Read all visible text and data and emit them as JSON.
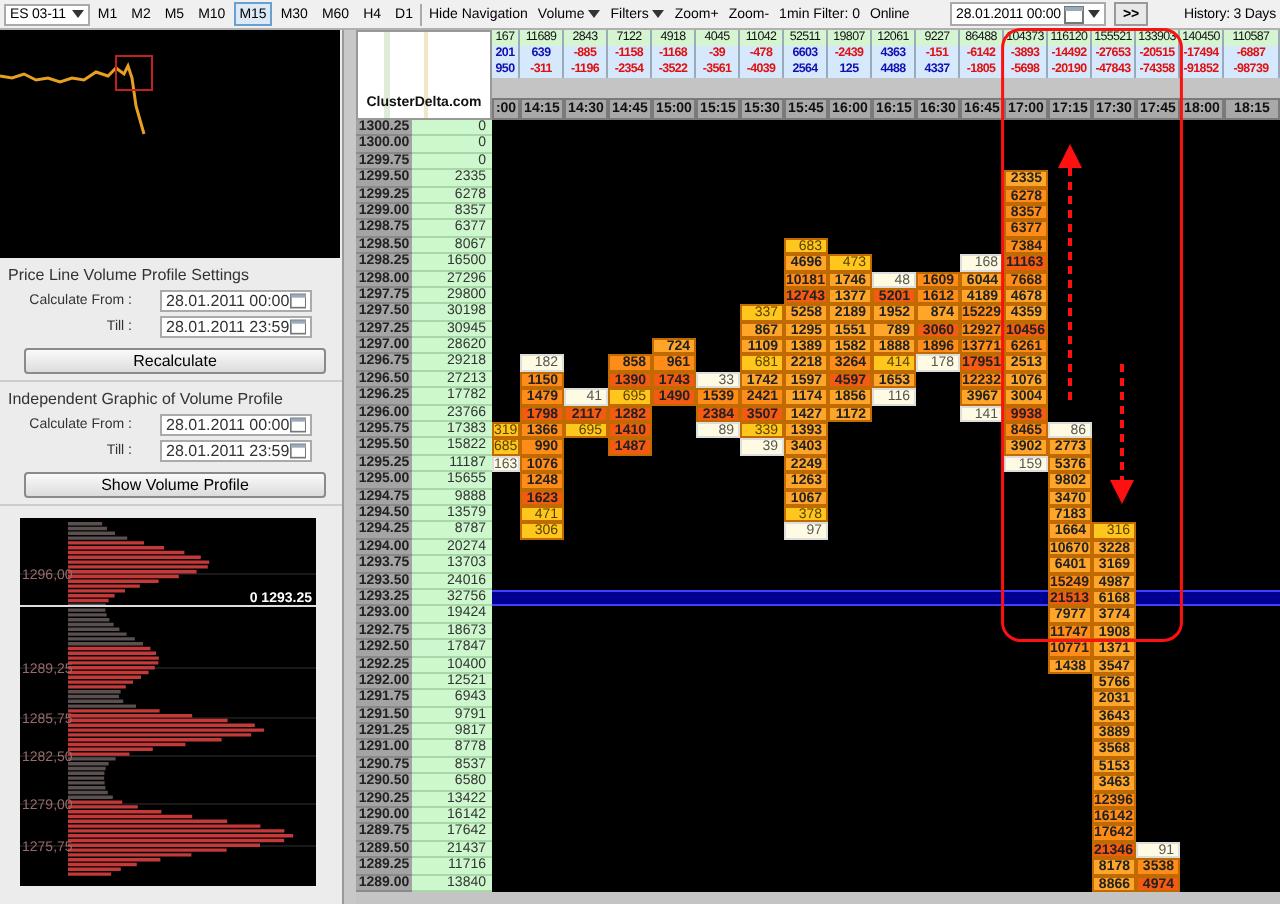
{
  "toolbar": {
    "symbol": "ES 03-11",
    "timeframes": [
      {
        "label": "M1",
        "selected": false
      },
      {
        "label": "M2",
        "selected": false
      },
      {
        "label": "M5",
        "selected": false
      },
      {
        "label": "M10",
        "selected": false
      },
      {
        "label": "M15",
        "selected": true
      },
      {
        "label": "M30",
        "selected": false
      },
      {
        "label": "M60",
        "selected": false
      },
      {
        "label": "H4",
        "selected": false
      },
      {
        "label": "D1",
        "selected": false
      }
    ],
    "actions": [
      {
        "label": "Hide Navigation",
        "kind": "button"
      },
      {
        "label": "Volume",
        "kind": "menu"
      },
      {
        "label": "Filters",
        "kind": "menu"
      },
      {
        "label": "Zoom+",
        "kind": "button"
      },
      {
        "label": "Zoom-",
        "kind": "button"
      },
      {
        "label": "1min Filter: 0",
        "kind": "button"
      },
      {
        "label": "Online",
        "kind": "text"
      }
    ],
    "date": "28.01.2011 00:00",
    "go_button": ">>",
    "history": "History: 3 Days"
  },
  "price_line_settings": {
    "title": "Price Line Volume Profile Settings",
    "fields": [
      {
        "label": "Calculate From :",
        "value": "28.01.2011 00:00"
      },
      {
        "label": "Till :",
        "value": "28.01.2011 23:59"
      }
    ],
    "button": "Recalculate"
  },
  "volume_profile_settings": {
    "title": "Independent Graphic of Volume Profile",
    "fields": [
      {
        "label": "Calculate From :",
        "value": "28.01.2011 00:00"
      },
      {
        "label": "Till :",
        "value": "28.01.2011 23:59"
      }
    ],
    "button": "Show Volume Profile"
  },
  "volume_profile": {
    "price_labels": [
      "1296,00",
      "1289,25",
      "1285,75",
      "1282,50",
      "1279,00",
      "1275,75"
    ],
    "marker": "0 1293.25"
  },
  "logo": "ClusterDelta.com",
  "grid": {
    "totals": [
      "167",
      "11689",
      "2843",
      "7122",
      "4918",
      "4045",
      "11042",
      "52511",
      "19807",
      "12061",
      "9227",
      "86488",
      "104373",
      "116120",
      "155521",
      "133903",
      "140450",
      "110587"
    ],
    "deltas": [
      "201",
      "639",
      "-885",
      "-1158",
      "-1168",
      "-39",
      "-478",
      "6603",
      "-2439",
      "4363",
      "-151",
      "-6142",
      "-3893",
      "-14492",
      "-27653",
      "-20515",
      "-17494",
      "-6887"
    ],
    "cumulative_deltas": [
      "950",
      "-311",
      "-1196",
      "-2354",
      "-3522",
      "-3561",
      "-4039",
      "2564",
      "125",
      "4488",
      "4337",
      "-1805",
      "-5698",
      "-20190",
      "-47843",
      "-74358",
      "-91852",
      "-98739"
    ],
    "times": [
      ":00",
      "14:15",
      "14:30",
      "14:45",
      "15:00",
      "15:15",
      "15:30",
      "15:45",
      "16:00",
      "16:15",
      "16:30",
      "16:45",
      "17:00",
      "17:15",
      "17:30",
      "17:45",
      "18:00",
      "18:15"
    ],
    "rows": [
      {
        "price": "1300.25",
        "volume": "0",
        "current": false,
        "cells": [
          null,
          null,
          null,
          null,
          null,
          null,
          null,
          null,
          null,
          null,
          null,
          null,
          null,
          null,
          null,
          null,
          null,
          null
        ]
      },
      {
        "price": "1300.00",
        "volume": "0",
        "current": false,
        "cells": [
          null,
          null,
          null,
          null,
          null,
          null,
          null,
          null,
          null,
          null,
          null,
          null,
          null,
          null,
          null,
          null,
          null,
          null
        ]
      },
      {
        "price": "1299.75",
        "volume": "0",
        "current": false,
        "cells": [
          null,
          null,
          null,
          null,
          null,
          null,
          null,
          null,
          null,
          null,
          null,
          null,
          null,
          null,
          null,
          null,
          null,
          null
        ]
      },
      {
        "price": "1299.50",
        "volume": "2335",
        "current": false,
        "cells": [
          null,
          null,
          null,
          null,
          null,
          null,
          null,
          null,
          null,
          null,
          null,
          null,
          "2335",
          null,
          null,
          null,
          null,
          null
        ]
      },
      {
        "price": "1299.25",
        "volume": "6278",
        "current": false,
        "cells": [
          null,
          null,
          null,
          null,
          null,
          null,
          null,
          null,
          null,
          null,
          null,
          null,
          "6278",
          null,
          null,
          null,
          null,
          null
        ]
      },
      {
        "price": "1299.00",
        "volume": "8357",
        "current": false,
        "cells": [
          null,
          null,
          null,
          null,
          null,
          null,
          null,
          null,
          null,
          null,
          null,
          null,
          "8357",
          null,
          null,
          null,
          null,
          null
        ]
      },
      {
        "price": "1298.75",
        "volume": "6377",
        "current": false,
        "cells": [
          null,
          null,
          null,
          null,
          null,
          null,
          null,
          null,
          null,
          null,
          null,
          null,
          "6377",
          null,
          null,
          null,
          null,
          null
        ]
      },
      {
        "price": "1298.50",
        "volume": "8067",
        "current": false,
        "cells": [
          null,
          null,
          null,
          null,
          null,
          null,
          null,
          "683",
          null,
          null,
          null,
          null,
          "7384",
          null,
          null,
          null,
          null,
          null
        ]
      },
      {
        "price": "1298.25",
        "volume": "16500",
        "current": false,
        "cells": [
          null,
          null,
          null,
          null,
          null,
          null,
          null,
          "4696",
          "473",
          null,
          null,
          "168",
          "11163",
          null,
          null,
          null,
          null,
          null
        ]
      },
      {
        "price": "1298.00",
        "volume": "27296",
        "current": false,
        "cells": [
          null,
          null,
          null,
          null,
          null,
          null,
          null,
          "10181",
          "1746",
          "48",
          "1609",
          "6044",
          "7668",
          null,
          null,
          null,
          null,
          null
        ]
      },
      {
        "price": "1297.75",
        "volume": "29800",
        "current": false,
        "cells": [
          null,
          null,
          null,
          null,
          null,
          null,
          null,
          "12743",
          "1377",
          "5201",
          "1612",
          "4189",
          "4678",
          null,
          null,
          null,
          null,
          null
        ]
      },
      {
        "price": "1297.50",
        "volume": "30198",
        "current": false,
        "cells": [
          null,
          null,
          null,
          null,
          null,
          null,
          "337",
          "5258",
          "2189",
          "1952",
          "874",
          "15229",
          "4359",
          null,
          null,
          null,
          null,
          null
        ]
      },
      {
        "price": "1297.25",
        "volume": "30945",
        "current": false,
        "cells": [
          null,
          null,
          null,
          null,
          null,
          null,
          "867",
          "1295",
          "1551",
          "789",
          "3060",
          "12927",
          "10456",
          null,
          null,
          null,
          null,
          null
        ]
      },
      {
        "price": "1297.00",
        "volume": "28620",
        "current": false,
        "cells": [
          null,
          null,
          null,
          null,
          "724",
          null,
          "1109",
          "1389",
          "1582",
          "1888",
          "1896",
          "13771",
          "6261",
          null,
          null,
          null,
          null,
          null
        ]
      },
      {
        "price": "1296.75",
        "volume": "29218",
        "current": false,
        "cells": [
          null,
          "182",
          null,
          "858",
          "961",
          null,
          "681",
          "2218",
          "3264",
          "414",
          "178",
          "17951",
          "2513",
          null,
          null,
          null,
          null,
          null
        ]
      },
      {
        "price": "1296.50",
        "volume": "27213",
        "current": false,
        "cells": [
          null,
          "1150",
          null,
          "1390",
          "1743",
          "33",
          "1742",
          "1597",
          "4597",
          "1653",
          null,
          "12232",
          "1076",
          null,
          null,
          null,
          null,
          null
        ]
      },
      {
        "price": "1296.25",
        "volume": "17782",
        "current": false,
        "cells": [
          null,
          "1479",
          "41",
          "695",
          "1490",
          "1539",
          "2421",
          "1174",
          "1856",
          "116",
          null,
          "3967",
          "3004",
          null,
          null,
          null,
          null,
          null
        ]
      },
      {
        "price": "1296.00",
        "volume": "23766",
        "current": false,
        "cells": [
          null,
          "1798",
          "2117",
          "1282",
          null,
          "2384",
          "3507",
          "1427",
          "1172",
          null,
          null,
          "141",
          "9938",
          null,
          null,
          null,
          null,
          null
        ]
      },
      {
        "price": "1295.75",
        "volume": "17383",
        "current": false,
        "cells": [
          "319",
          "1366",
          "695",
          "1410",
          null,
          "89",
          "339",
          "1393",
          null,
          null,
          null,
          null,
          "8465",
          "86",
          null,
          null,
          null,
          null
        ]
      },
      {
        "price": "1295.50",
        "volume": "15822",
        "current": false,
        "cells": [
          "685",
          "990",
          null,
          "1487",
          null,
          null,
          "39",
          "3403",
          null,
          null,
          null,
          null,
          "3902",
          "2773",
          null,
          null,
          null,
          null
        ]
      },
      {
        "price": "1295.25",
        "volume": "11187",
        "current": false,
        "cells": [
          "163",
          "1076",
          null,
          null,
          null,
          null,
          null,
          "2249",
          null,
          null,
          null,
          null,
          "159",
          "5376",
          null,
          null,
          null,
          null
        ]
      },
      {
        "price": "1295.00",
        "volume": "15655",
        "current": false,
        "cells": [
          null,
          "1248",
          null,
          null,
          null,
          null,
          null,
          "1263",
          null,
          null,
          null,
          null,
          null,
          "9802",
          null,
          null,
          null,
          null
        ]
      },
      {
        "price": "1294.75",
        "volume": "9888",
        "current": false,
        "cells": [
          null,
          "1623",
          null,
          null,
          null,
          null,
          null,
          "1067",
          null,
          null,
          null,
          null,
          null,
          "3470",
          null,
          null,
          null,
          null
        ]
      },
      {
        "price": "1294.50",
        "volume": "13579",
        "current": false,
        "cells": [
          null,
          "471",
          null,
          null,
          null,
          null,
          null,
          "378",
          null,
          null,
          null,
          null,
          null,
          "7183",
          null,
          null,
          null,
          null
        ]
      },
      {
        "price": "1294.25",
        "volume": "8787",
        "current": false,
        "cells": [
          null,
          "306",
          null,
          null,
          null,
          null,
          null,
          "97",
          null,
          null,
          null,
          null,
          null,
          "1664",
          "316",
          null,
          null,
          null
        ]
      },
      {
        "price": "1294.00",
        "volume": "20274",
        "current": false,
        "cells": [
          null,
          null,
          null,
          null,
          null,
          null,
          null,
          null,
          null,
          null,
          null,
          null,
          null,
          "10670",
          "3228",
          null,
          null,
          null
        ]
      },
      {
        "price": "1293.75",
        "volume": "13703",
        "current": false,
        "cells": [
          null,
          null,
          null,
          null,
          null,
          null,
          null,
          null,
          null,
          null,
          null,
          null,
          null,
          "6401",
          "3169",
          null,
          null,
          null
        ]
      },
      {
        "price": "1293.50",
        "volume": "24016",
        "current": false,
        "cells": [
          null,
          null,
          null,
          null,
          null,
          null,
          null,
          null,
          null,
          null,
          null,
          null,
          null,
          "15249",
          "4987",
          null,
          null,
          null
        ]
      },
      {
        "price": "1293.25",
        "volume": "32756",
        "current": true,
        "cells": [
          null,
          null,
          null,
          null,
          null,
          null,
          null,
          null,
          null,
          null,
          null,
          null,
          null,
          "21513",
          "6168",
          null,
          null,
          null
        ]
      },
      {
        "price": "1293.00",
        "volume": "19424",
        "current": false,
        "cells": [
          null,
          null,
          null,
          null,
          null,
          null,
          null,
          null,
          null,
          null,
          null,
          null,
          null,
          "7977",
          "3774",
          null,
          null,
          null
        ]
      },
      {
        "price": "1292.75",
        "volume": "18673",
        "current": false,
        "cells": [
          null,
          null,
          null,
          null,
          null,
          null,
          null,
          null,
          null,
          null,
          null,
          null,
          null,
          "11747",
          "1908",
          null,
          null,
          null
        ]
      },
      {
        "price": "1292.50",
        "volume": "17847",
        "current": false,
        "cells": [
          null,
          null,
          null,
          null,
          null,
          null,
          null,
          null,
          null,
          null,
          null,
          null,
          null,
          "10771",
          "1371",
          null,
          null,
          null
        ]
      },
      {
        "price": "1292.25",
        "volume": "10400",
        "current": false,
        "cells": [
          null,
          null,
          null,
          null,
          null,
          null,
          null,
          null,
          null,
          null,
          null,
          null,
          null,
          "1438",
          "3547",
          null,
          null,
          null
        ]
      },
      {
        "price": "1292.00",
        "volume": "12521",
        "current": false,
        "cells": [
          null,
          null,
          null,
          null,
          null,
          null,
          null,
          null,
          null,
          null,
          null,
          null,
          null,
          null,
          "5766",
          null,
          null,
          null
        ]
      },
      {
        "price": "1291.75",
        "volume": "6943",
        "current": false,
        "cells": [
          null,
          null,
          null,
          null,
          null,
          null,
          null,
          null,
          null,
          null,
          null,
          null,
          null,
          null,
          "2031",
          null,
          null,
          null
        ]
      },
      {
        "price": "1291.50",
        "volume": "9791",
        "current": false,
        "cells": [
          null,
          null,
          null,
          null,
          null,
          null,
          null,
          null,
          null,
          null,
          null,
          null,
          null,
          null,
          "3643",
          null,
          null,
          null
        ]
      },
      {
        "price": "1291.25",
        "volume": "9817",
        "current": false,
        "cells": [
          null,
          null,
          null,
          null,
          null,
          null,
          null,
          null,
          null,
          null,
          null,
          null,
          null,
          null,
          "3889",
          null,
          null,
          null
        ]
      },
      {
        "price": "1291.00",
        "volume": "8778",
        "current": false,
        "cells": [
          null,
          null,
          null,
          null,
          null,
          null,
          null,
          null,
          null,
          null,
          null,
          null,
          null,
          null,
          "3568",
          null,
          null,
          null
        ]
      },
      {
        "price": "1290.75",
        "volume": "8537",
        "current": false,
        "cells": [
          null,
          null,
          null,
          null,
          null,
          null,
          null,
          null,
          null,
          null,
          null,
          null,
          null,
          null,
          "5153",
          null,
          null,
          null
        ]
      },
      {
        "price": "1290.50",
        "volume": "6580",
        "current": false,
        "cells": [
          null,
          null,
          null,
          null,
          null,
          null,
          null,
          null,
          null,
          null,
          null,
          null,
          null,
          null,
          "3463",
          null,
          null,
          null
        ]
      },
      {
        "price": "1290.25",
        "volume": "13422",
        "current": false,
        "cells": [
          null,
          null,
          null,
          null,
          null,
          null,
          null,
          null,
          null,
          null,
          null,
          null,
          null,
          null,
          "12396",
          null,
          null,
          null
        ]
      },
      {
        "price": "1290.00",
        "volume": "16142",
        "current": false,
        "cells": [
          null,
          null,
          null,
          null,
          null,
          null,
          null,
          null,
          null,
          null,
          null,
          null,
          null,
          null,
          "16142",
          null,
          null,
          null
        ]
      },
      {
        "price": "1289.75",
        "volume": "17642",
        "current": false,
        "cells": [
          null,
          null,
          null,
          null,
          null,
          null,
          null,
          null,
          null,
          null,
          null,
          null,
          null,
          null,
          "17642",
          null,
          null,
          null
        ]
      },
      {
        "price": "1289.50",
        "volume": "21437",
        "current": false,
        "cells": [
          null,
          null,
          null,
          null,
          null,
          null,
          null,
          null,
          null,
          null,
          null,
          null,
          null,
          null,
          "21346",
          "91",
          null,
          null
        ]
      },
      {
        "price": "1289.25",
        "volume": "11716",
        "current": false,
        "cells": [
          null,
          null,
          null,
          null,
          null,
          null,
          null,
          null,
          null,
          null,
          null,
          null,
          null,
          null,
          "8178",
          "3538",
          null,
          null
        ]
      },
      {
        "price": "1289.00",
        "volume": "13840",
        "current": false,
        "cells": [
          null,
          null,
          null,
          null,
          null,
          null,
          null,
          null,
          null,
          null,
          null,
          null,
          null,
          null,
          "8866",
          "4974",
          null,
          null
        ]
      }
    ]
  }
}
